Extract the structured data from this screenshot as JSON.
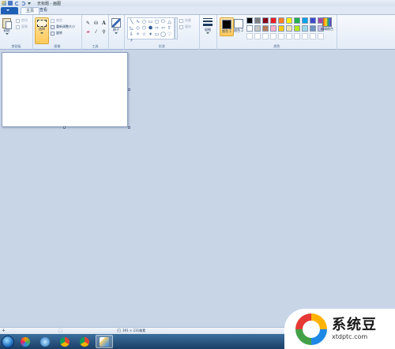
{
  "window": {
    "title": "无标题 - 画图"
  },
  "tabs": {
    "file_label": "",
    "home_label": "主页",
    "view_label": "查看"
  },
  "clipboard": {
    "paste_label": "粘贴",
    "cut_label": "剪切",
    "copy_label": "复制",
    "group_label": "剪贴板"
  },
  "image": {
    "select_label": "选择",
    "crop_label": "裁剪",
    "resize_label": "重新调整大小",
    "rotate_label": "旋转",
    "group_label": "图像"
  },
  "tools": {
    "group_label": "工具",
    "items": [
      "pencil-icon",
      "fill-icon",
      "text-icon",
      "eraser-icon",
      "color-picker-icon",
      "magnifier-icon"
    ]
  },
  "brushes": {
    "label": "刷子"
  },
  "shapes": {
    "group_label": "形状",
    "outline_label": "轮廓",
    "fill_label": "填充",
    "glyphs": [
      "╲",
      "∿",
      "○",
      "▭",
      "▢",
      "⬠",
      "△",
      "◺",
      "◇",
      "⬡",
      "⬢",
      "⇨",
      "⇦",
      "⇧",
      "⇩",
      "✧",
      "☆",
      "✶",
      "▭",
      "◯",
      "♡",
      "⚡"
    ]
  },
  "size": {
    "label": "粗细"
  },
  "colors": {
    "group_label": "颜色",
    "color1_label": "颜色 1",
    "color2_label": "颜色 2",
    "color1_value": "#000000",
    "color2_value": "#ffffff",
    "edit_label": "编辑颜色",
    "palette": [
      "#000000",
      "#7f7f7f",
      "#880015",
      "#ed1c24",
      "#ff7f27",
      "#fff200",
      "#22b14c",
      "#00a2e8",
      "#3f48cc",
      "#a349a4",
      "#ffffff",
      "#c3c3c3",
      "#b97a57",
      "#ffaec9",
      "#ffc90e",
      "#efe4b0",
      "#b5e61d",
      "#99d9ea",
      "#7092be",
      "#c8bfe7",
      "",
      "",
      "",
      "",
      "",
      "",
      "",
      "",
      "",
      ""
    ]
  },
  "status": {
    "canvas_size": "391 × 231像素"
  },
  "taskbar": {
    "items": [
      "media-player-icon",
      "photos-icon",
      "browser-icon",
      "chrome-icon",
      "chrome-icon",
      "paint-icon"
    ]
  },
  "watermark": {
    "title": "系统豆",
    "url": "xtdptc.com"
  }
}
